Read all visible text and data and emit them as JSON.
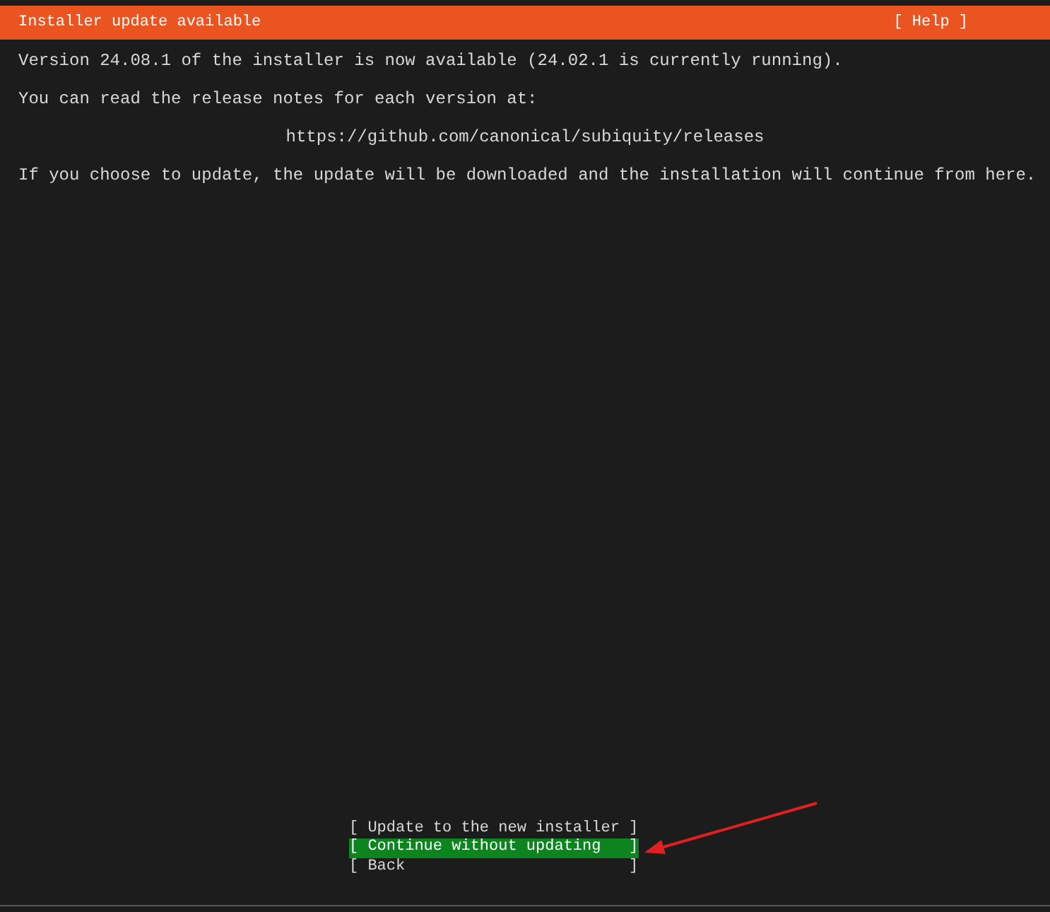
{
  "header": {
    "title": "Installer update available",
    "help": "[ Help ]"
  },
  "lines": [
    {
      "kind": "text",
      "text": "Version 24.08.1 of the installer is now available (24.02.1 is currently running)."
    },
    {
      "kind": "text",
      "text": "You can read the release notes for each version at:"
    },
    {
      "kind": "url",
      "text": "https://github.com/canonical/subiquity/releases"
    },
    {
      "kind": "text",
      "text": "If you choose to update, the update will be downloaded and the installation will continue from here."
    }
  ],
  "buttons": [
    {
      "label": "[ Update to the new installer ]",
      "selected": false
    },
    {
      "label": "[ Continue without updating   ]",
      "selected": true
    },
    {
      "label": "[ Back                        ]",
      "selected": false
    }
  ]
}
